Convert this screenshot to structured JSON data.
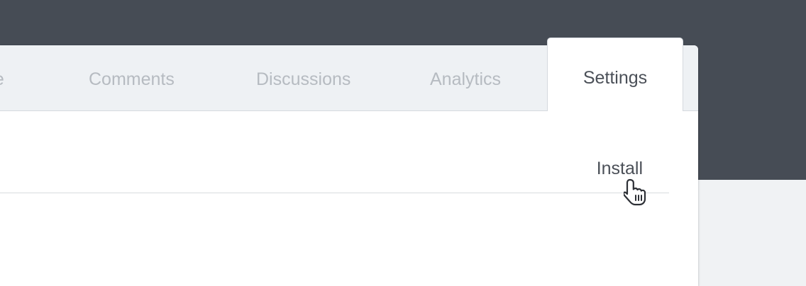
{
  "tabs": {
    "partial_label": "ne",
    "comments_label": "Comments",
    "discussions_label": "Discussions",
    "analytics_label": "Analytics",
    "settings_label": "Settings",
    "active_tab": "Settings"
  },
  "content": {
    "install_label": "Install"
  },
  "colors": {
    "header_bg": "#464c55",
    "tabbar_bg": "#eef1f4",
    "inactive_tab_text": "#b6bbc1",
    "active_tab_text": "#4b5058"
  },
  "icons": {
    "cursor": "hand-pointer-icon"
  }
}
